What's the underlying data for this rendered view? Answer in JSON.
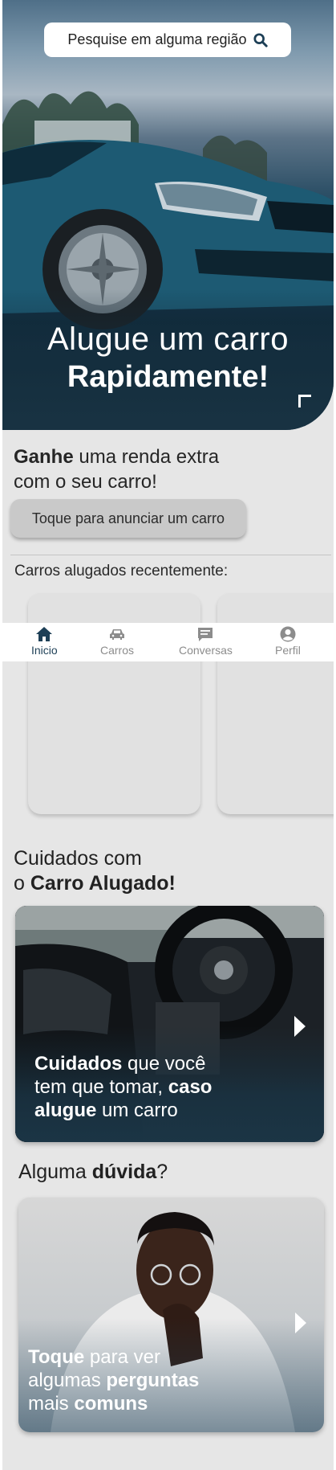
{
  "search": {
    "placeholder": "Pesquise em alguma região",
    "icon": "search-icon"
  },
  "hero": {
    "title_line1": "Alugue um carro",
    "title_line2": "Rapidamente!"
  },
  "earn": {
    "bold": "Ganhe",
    "rest_line1": " uma renda extra",
    "line2": "com o seu carro!",
    "button_label": "Toque para anunciar um carro"
  },
  "recent": {
    "label": "Carros alugados recentemente:"
  },
  "nav": {
    "items": [
      {
        "label": "Inicio",
        "icon": "home-icon",
        "active": true
      },
      {
        "label": "Carros",
        "icon": "car-icon",
        "active": false
      },
      {
        "label": "Conversas",
        "icon": "chat-icon",
        "active": false
      },
      {
        "label": "Perfil",
        "icon": "user-icon",
        "active": false
      }
    ],
    "active_color": "#1d3f56",
    "inactive_color": "#8c8c8c"
  },
  "care": {
    "title_line1": "Cuidados com",
    "title_line2_prefix": "o ",
    "title_line2_bold": "Carro Alugado!",
    "card": {
      "bold1": "Cuidados",
      "text1": " que você",
      "text2": "tem que tomar, ",
      "bold2": "caso",
      "bold3": "alugue",
      "text3": " um carro"
    }
  },
  "doubt": {
    "title_prefix": "Alguma ",
    "title_bold": "dúvida",
    "title_suffix": "?",
    "card": {
      "bold1": "Toque",
      "text1": " para ver",
      "text2": "algumas ",
      "bold2": "perguntas",
      "text3": "mais ",
      "bold3": "comuns"
    }
  },
  "colors": {
    "accent": "#1d3f56",
    "background": "#e6e6e6",
    "button": "#c9c9c9"
  }
}
